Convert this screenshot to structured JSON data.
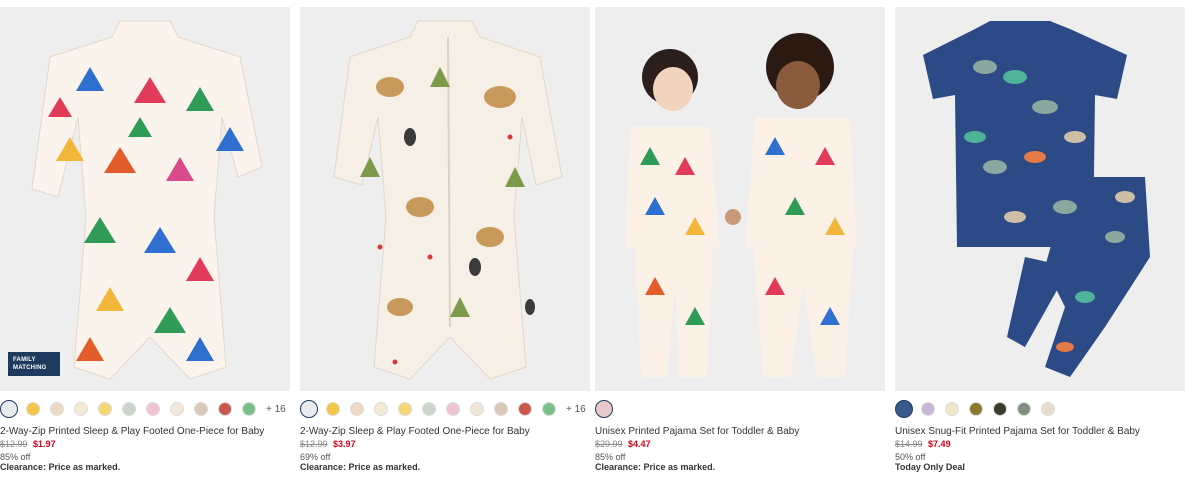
{
  "products": [
    {
      "badge": "FAMILY MATCHING",
      "swatches": [
        "#e9ecef",
        "#f3c646",
        "#f0d9c4",
        "#f4ead1",
        "#f7d774",
        "#c9d6c9",
        "#f0c4cf",
        "#f2e6d8",
        "#d9c8b5",
        "#c9584a",
        "#7bbf88"
      ],
      "more_colors": "+ 16",
      "name": "2-Way-Zip Printed Sleep & Play Footed One-Piece for Baby",
      "was_price": "$12.99",
      "sale_price": "$1.97",
      "discount": "85% off",
      "note": "Clearance: Price as marked."
    },
    {
      "badge": "",
      "swatches": [
        "#e9ecef",
        "#f3c646",
        "#f0d9c4",
        "#f4ead1",
        "#f7d774",
        "#c9d6c9",
        "#f0c4cf",
        "#f2e6d8",
        "#d9c8b5",
        "#c9584a",
        "#7bbf88"
      ],
      "more_colors": "+ 16",
      "name": "2-Way-Zip Sleep & Play Footed One-Piece for Baby",
      "was_price": "$12.99",
      "sale_price": "$3.97",
      "discount": "69% off",
      "note": "Clearance: Price as marked."
    },
    {
      "badge": "",
      "swatches": [
        "#e8c9c9"
      ],
      "more_colors": "",
      "name": "Unisex Printed Pajama Set for Toddler & Baby",
      "was_price": "$29.99",
      "sale_price": "$4.47",
      "discount": "85% off",
      "note": "Clearance: Price as marked."
    },
    {
      "badge": "",
      "swatches": [
        "#3a5a8c",
        "#c5b4d6",
        "#efe6cc",
        "#8b7a2e",
        "#3b3b2a",
        "#7f8f7f",
        "#e9dccd"
      ],
      "more_colors": "",
      "name": "Unisex Snug-Fit Printed Pajama Set for Toddler & Baby",
      "was_price": "$14.99",
      "sale_price": "$7.49",
      "discount": "50% off",
      "note": "Today Only Deal"
    }
  ]
}
